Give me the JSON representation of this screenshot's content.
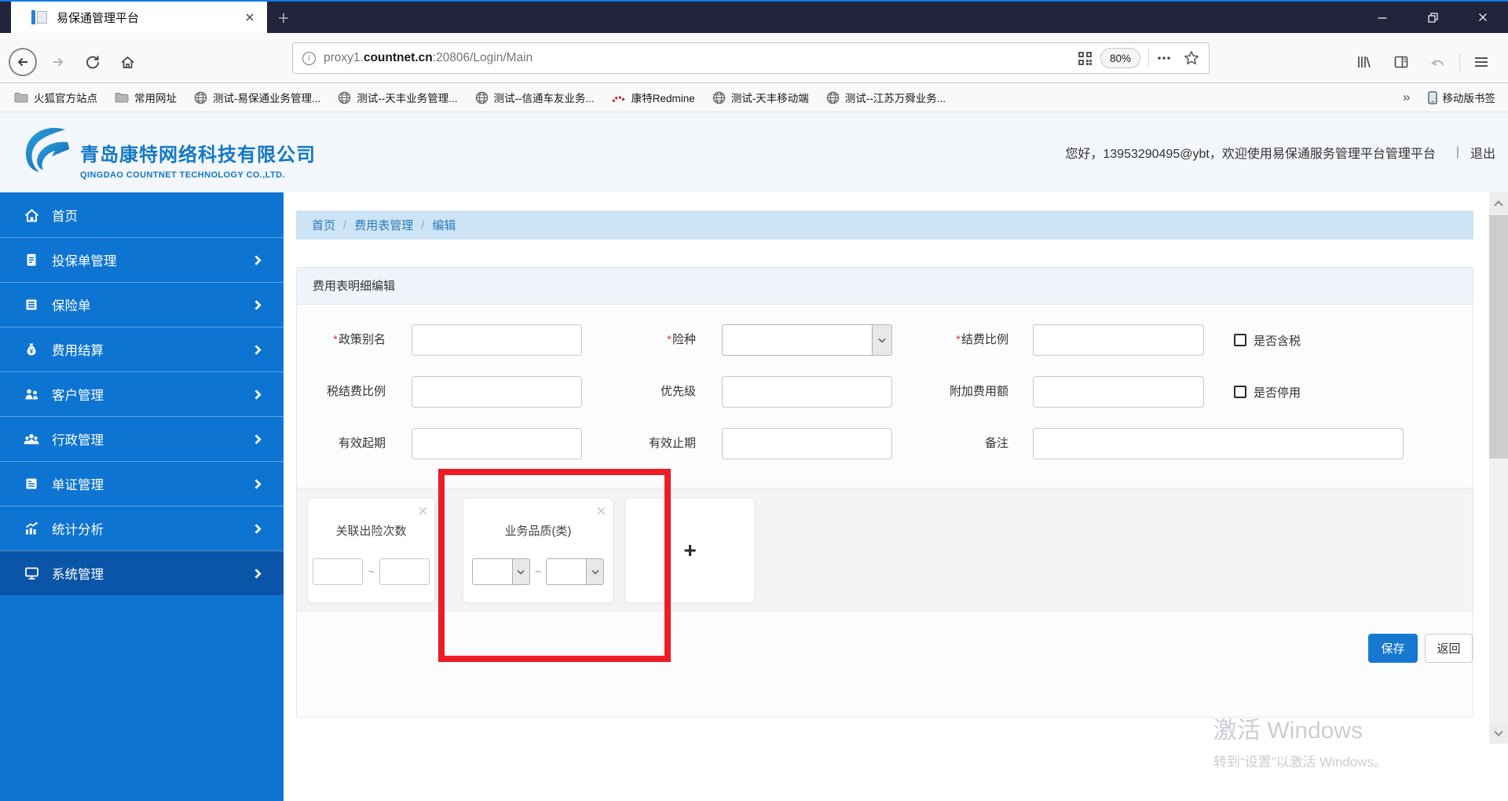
{
  "browser": {
    "tab_title": "易保通管理平台",
    "url_pre": "proxy1.",
    "url_host": "countnet.cn",
    "url_post": ":20806/Login/Main",
    "zoom_level": "80%",
    "bookmarks_overflow": "»",
    "mobile_bookmarks_label": "移动版书签",
    "bookmarks": [
      {
        "icon": "folder",
        "label": "火狐官方站点"
      },
      {
        "icon": "folder",
        "label": "常用网址"
      },
      {
        "icon": "globe",
        "label": "测试-易保通业务管理..."
      },
      {
        "icon": "globe",
        "label": "测试--天丰业务管理..."
      },
      {
        "icon": "globe",
        "label": "测试--信通车友业务..."
      },
      {
        "icon": "redmine",
        "label": "康特Redmine"
      },
      {
        "icon": "globe",
        "label": "测试-天丰移动端"
      },
      {
        "icon": "globe",
        "label": "测试--江苏万舜业务..."
      }
    ]
  },
  "header": {
    "company_cn": "青岛康特网络科技有限公司",
    "company_en": "QINGDAO COUNTNET TECHNOLOGY CO.,LTD.",
    "greeting": "您好，13953290495@ybt，欢迎使用易保通服务管理平台管理平台",
    "divider": "|",
    "logout": "退出"
  },
  "sidebar": {
    "items": [
      {
        "label": "首页",
        "icon": "home"
      },
      {
        "label": "投保单管理",
        "icon": "document"
      },
      {
        "label": "保险单",
        "icon": "policy-list"
      },
      {
        "label": "费用结算",
        "icon": "money-bag"
      },
      {
        "label": "客户管理",
        "icon": "customers"
      },
      {
        "label": "行政管理",
        "icon": "admin-group"
      },
      {
        "label": "单证管理",
        "icon": "certificates"
      },
      {
        "label": "统计分析",
        "icon": "statistics"
      },
      {
        "label": "系统管理",
        "icon": "system"
      }
    ]
  },
  "breadcrumb": {
    "home": "首页",
    "section": "费用表管理",
    "current": "编辑",
    "separator": "/"
  },
  "panel": {
    "title": "费用表明细编辑",
    "required_mark": "*",
    "labels": {
      "policy_alias": "政策别名",
      "insurance_type": "险种",
      "settlement_ratio": "结费比例",
      "tax_settlement_ratio": "税结费比例",
      "priority": "优先级",
      "additional_fee": "附加费用额",
      "valid_from": "有效起期",
      "valid_to": "有效止期",
      "remark": "备注",
      "tax_included": "是否含税",
      "suspended": "是否停用"
    },
    "cards": {
      "claim_count_title": "关联出险次数",
      "business_quality_title": "业务品质(类)",
      "range_separator": "~",
      "add_label": "+"
    },
    "buttons": {
      "save": "保存",
      "back": "返回"
    }
  },
  "watermark": {
    "line1": "激活 Windows",
    "line2": "转到“设置”以激活 Windows。"
  },
  "colors": {
    "sidebar_blue": "#0e74d2",
    "sidebar_active_blue": "#0b55a8",
    "brand_blue": "#1379c6",
    "save_blue": "#1778d2",
    "annotation_red": "#ee1c25"
  }
}
